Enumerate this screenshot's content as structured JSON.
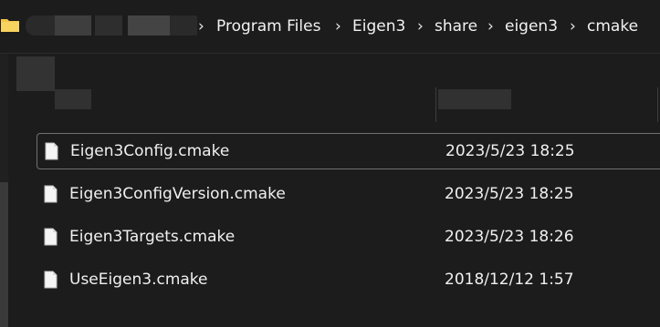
{
  "breadcrumb": {
    "items": [
      "Program Files",
      "Eigen3",
      "share",
      "eigen3",
      "cmake"
    ],
    "separator": "›"
  },
  "files": [
    {
      "name": "Eigen3Config.cmake",
      "modified": "2023/5/23 18:25",
      "selected": true
    },
    {
      "name": "Eigen3ConfigVersion.cmake",
      "modified": "2023/5/23 18:25",
      "selected": false
    },
    {
      "name": "Eigen3Targets.cmake",
      "modified": "2023/5/23 18:26",
      "selected": false
    },
    {
      "name": "UseEigen3.cmake",
      "modified": "2018/12/12 1:57",
      "selected": false
    }
  ],
  "icons": {
    "folder": "folder-icon",
    "file": "document-icon"
  },
  "colors": {
    "background": "#1c1c1c",
    "text": "#f0f0f0",
    "folder": "#f4c54a",
    "selection_border": "#707070"
  }
}
